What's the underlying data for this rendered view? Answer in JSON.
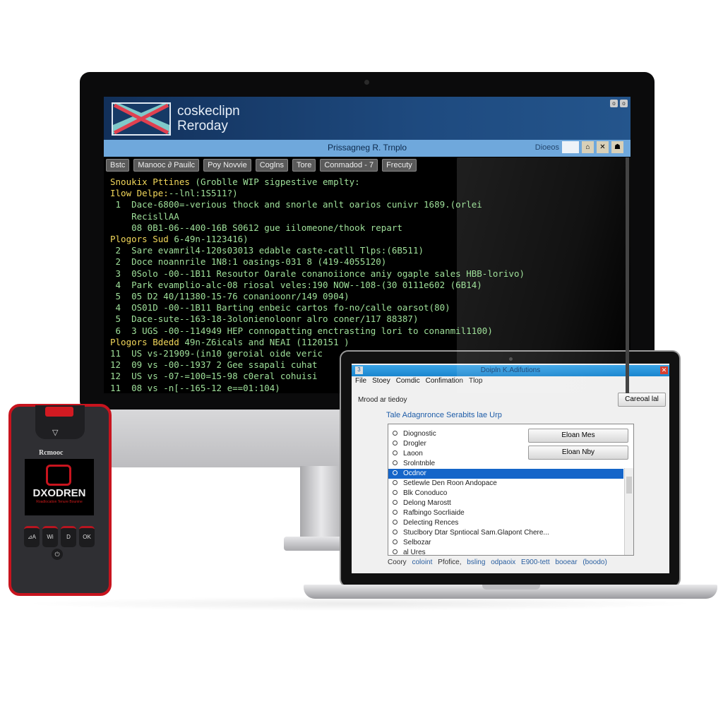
{
  "monitor": {
    "brand": [
      "coskeclipn",
      "Reroday"
    ],
    "window_buttons": [
      "o",
      "o"
    ],
    "subtitle": "Prissagneg R. Trnplo",
    "search_label": "Dioeos",
    "toolbar": [
      "Bstc",
      "Manooc ∂ Pauilc",
      "Poy Novvie",
      "Coglns",
      "Tore",
      "Conmadod - 7",
      "Frecuty"
    ],
    "lines": [
      {
        "t": "Snoukix Pttines",
        "r": " (Groblle WIP sigpestive emplty:",
        "h": true
      },
      {
        "t": "Ilow Delpe:",
        "r": "--lnl:1S511?)",
        "h": true
      },
      {
        "t": " 1  Dace-6800=-verious thock and snorle anlt oarios cunivr 1689.(orlei",
        "h": false
      },
      {
        "t": "    RecisllAA",
        "h": false
      },
      {
        "t": "    08 0B1-06--400-16B S0612 gue iilomeone/thook repart",
        "h": false
      },
      {
        "t": "Plogors Sud",
        "r": " 6-49n-1123416)",
        "h": true
      },
      {
        "t": " 2  Sare evamril4-120s03013 edable caste-catll Tlps:(6B511)",
        "h": false
      },
      {
        "t": " 2  Doce noannrile 1N8:1 oasings-031 8 (419-4055120)",
        "h": false
      },
      {
        "t": " 3  0Solo -00--1B11 Resoutor Oarale conanoiionce aniy ogaple sales HBB-lorivo)",
        "h": false
      },
      {
        "t": " 4  Park evamplio-alc-08 riosal veles:190 NOW--108-(30 0111e602 (6B14)",
        "h": false
      },
      {
        "t": " 5  05 D2 40/11380-15-76 conanioonr/149 0904)",
        "h": false
      },
      {
        "t": " 4  OS01D -00--1B11 Barting enbeic cartos fo-no/calle oarsot(80)",
        "h": false
      },
      {
        "t": " 5  Dace-sute--163-18-3olonienoloonr alro coner/117 88387)",
        "h": false
      },
      {
        "t": " 6  3 UGS -00--114949 HEP connopatting enctrasting lori to conanmil1100)",
        "h": false
      },
      {
        "t": "Plogors Bdedd",
        "r": " 49n-Z6icals and NEAI (1120151 )",
        "h": true
      },
      {
        "t": "11  US vs-21909-(in10 geroial oide veric",
        "h": false
      },
      {
        "t": "12  09 vs -00--1937 2 Gee ssapali cuhat",
        "h": false
      },
      {
        "t": "12  US vs -07-=100=15-98 c0eral cohuisi",
        "h": false
      },
      {
        "t": "11  08 vs -n[--165-12 e==01:104)",
        "h": false
      }
    ]
  },
  "laptop": {
    "title": "Doipln K.Adifutions",
    "menu": [
      "File",
      "Stoey",
      "Comdic",
      "Confimation",
      "Tlop"
    ],
    "description": "Mrood ar tiedoy",
    "cancel": "Careoal lal",
    "heading": "Tale Adagnronce Serabits lae Urp",
    "buttons": [
      "Eloan Mes",
      "Eloan Nby"
    ],
    "items": [
      "Diognostic",
      "Drogler",
      "Laoon",
      "Srolntnble",
      "Ocdnor",
      "Setlewle Den Roon Andopace",
      "Blk Conoduco",
      "Delong Marostt",
      "Rafbingo Socrliaide",
      "Delecting Rences",
      "Stuclbory Dtar Spntiocal Sam.Glapont Chere...",
      "Selbozar",
      "al Ures"
    ],
    "selected_index": 4,
    "footer": [
      "Coory",
      "coloint",
      "Pfofice,",
      "bsling",
      "odpaoix",
      "E900-tett",
      "booear",
      "(boodo)"
    ]
  },
  "device": {
    "label": "Rcmooc",
    "screen_brand": "DXODREN",
    "tagline": "Roadlocation Tenure Bounine",
    "keys": [
      "⊿A",
      "Wi",
      "D",
      "OK"
    ],
    "accent": "#c8141e"
  },
  "colors": {
    "terminal_text": "#9fe09a",
    "terminal_heading": "#f2d75a",
    "header_blue": "#1e4a7f",
    "selection": "#1565c9"
  }
}
